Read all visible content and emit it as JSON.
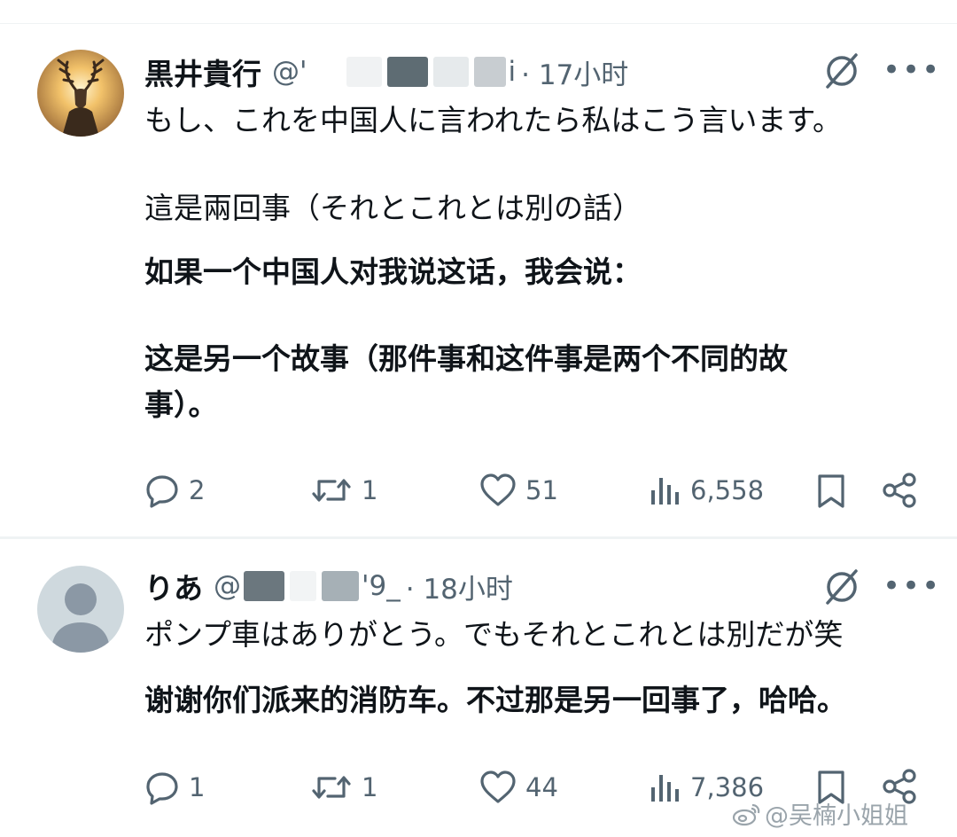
{
  "tweets": [
    {
      "author": "黒井貴行",
      "handle_prefix": "@'",
      "handle_suffix": "i",
      "time": "· 17小时",
      "lines": [
        "もし、これを中国人に言われたら私はこう言います。",
        "這是兩回事（それとこれとは別の話）",
        "如果一个中国人对我说这话，我会说：",
        "这是另一个故事（那件事和这件事是两个不同的故",
        "事）。"
      ],
      "replies": "2",
      "reposts": "1",
      "likes": "51",
      "views": "6,558"
    },
    {
      "author": "りあ",
      "handle_prefix": "@",
      "handle_suffix": "'9_",
      "time": "· 18小时",
      "lines": [
        "ポンプ車はありがとう。でもそれとこれとは別だが笑",
        "谢谢你们派来的消防车。不过那是另一回事了，哈哈。"
      ],
      "replies": "1",
      "reposts": "1",
      "likes": "44",
      "views": "7,386"
    }
  ],
  "icons": [
    "reply-icon",
    "repost-icon",
    "like-icon",
    "views-icon",
    "bookmark-icon",
    "share-icon",
    "grok-icon",
    "more-icon",
    "weibo-icon"
  ],
  "more_glyph": "•••",
  "watermark": "@吴楠小姐姐",
  "colors": {
    "text": "#0f1419",
    "secondary": "#536471",
    "divider": "#eff3f4"
  }
}
